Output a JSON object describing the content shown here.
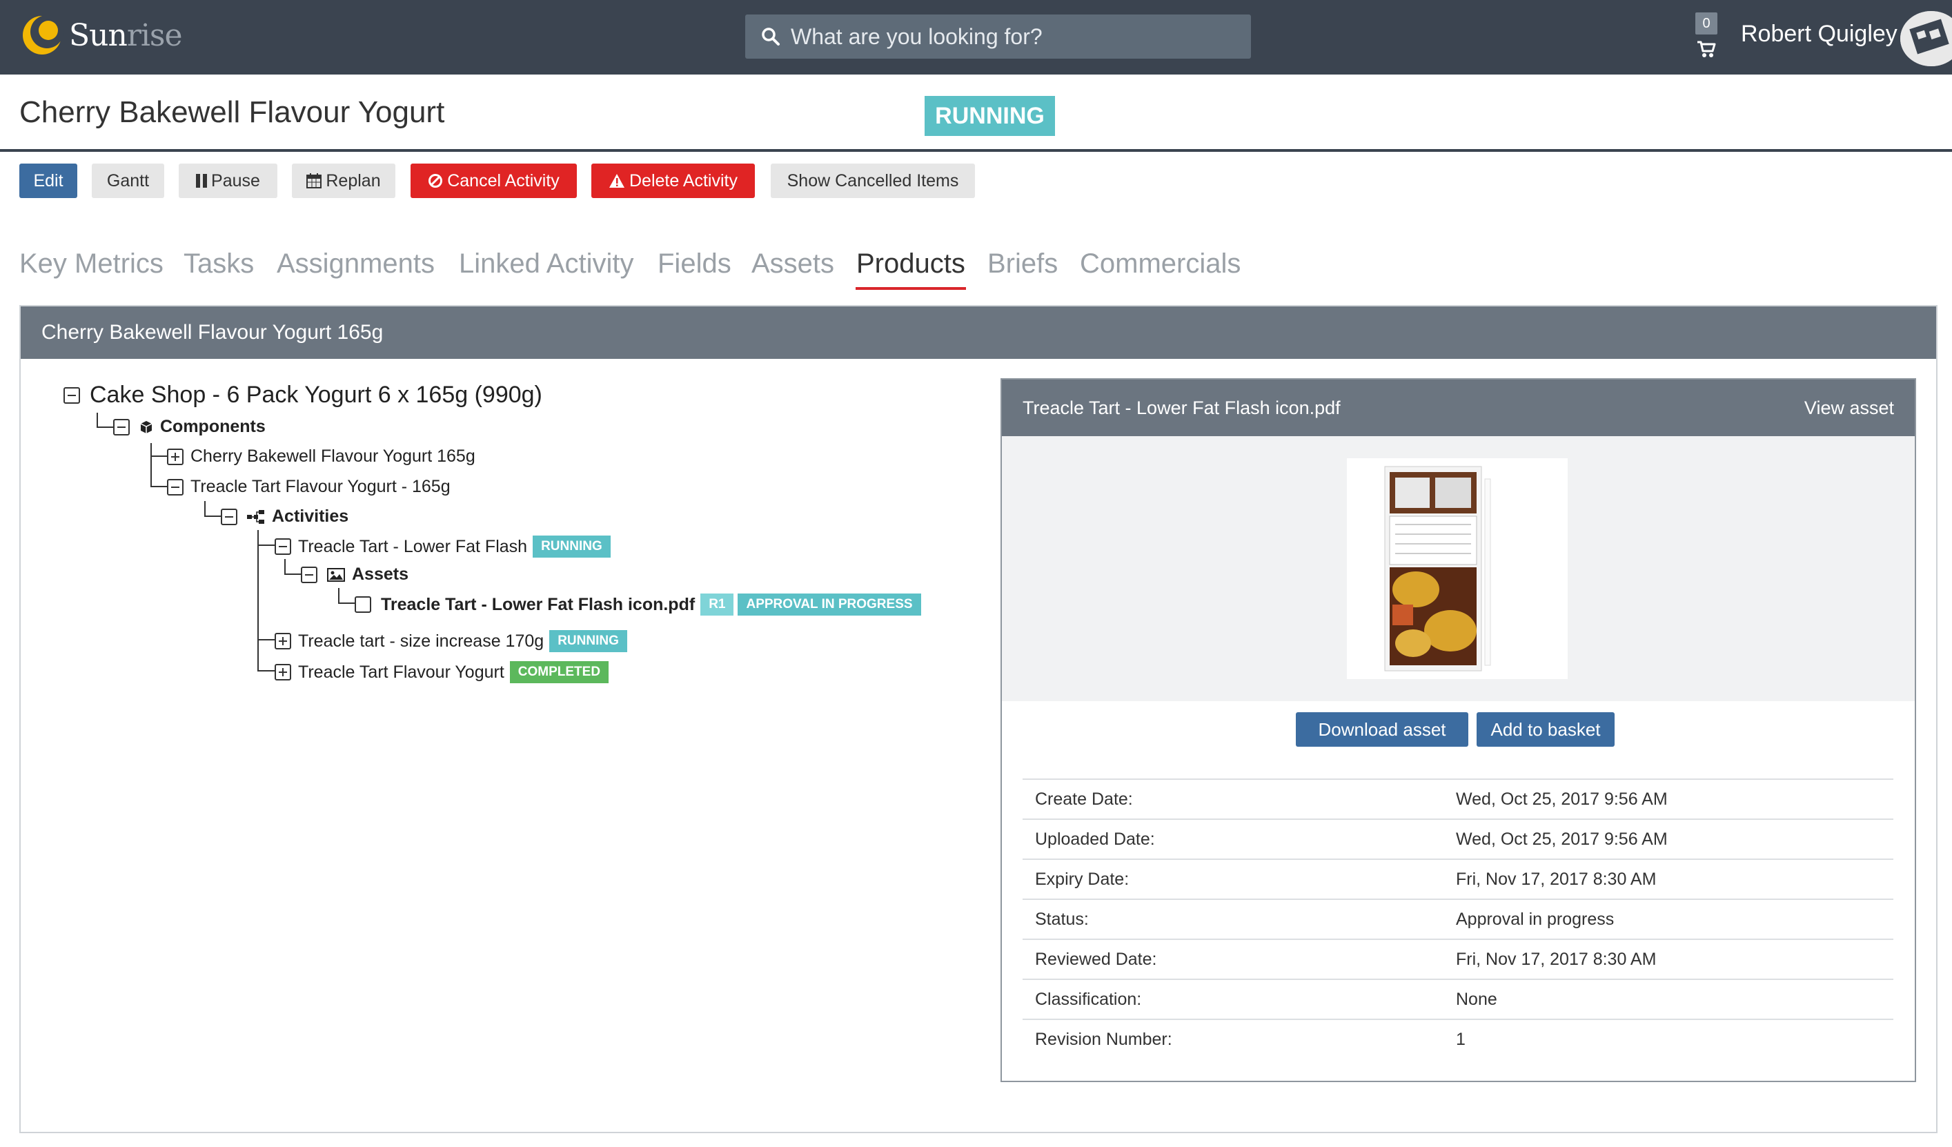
{
  "topbar": {
    "logo_a": "Sun",
    "logo_b": "rise",
    "search_placeholder": "What are you looking for?",
    "cart_count": "0",
    "user_name": "Robert Quigley"
  },
  "header": {
    "title": "Cherry Bakewell Flavour Yogurt",
    "status": "RUNNING"
  },
  "actions": {
    "edit": "Edit",
    "gantt": "Gantt",
    "pause": "Pause",
    "replan": "Replan",
    "cancel": "Cancel Activity",
    "delete": "Delete Activity",
    "show_cancelled": "Show Cancelled Items"
  },
  "tabs": [
    "Key Metrics",
    "Tasks",
    "Assignments",
    "Linked Activity",
    "Fields",
    "Assets",
    "Products",
    "Briefs",
    "Commercials"
  ],
  "active_tab": "Products",
  "panel": {
    "title": "Cherry Bakewell Flavour Yogurt 165g"
  },
  "tree": {
    "root": "Cake Shop - 6 Pack Yogurt 6 x 165g (990g)",
    "components": "Components",
    "comp1": "Cherry Bakewell Flavour Yogurt 165g",
    "comp2": "Treacle Tart Flavour Yogurt - 165g",
    "activities": "Activities",
    "act1": "Treacle Tart - Lower Fat Flash",
    "act1_badge": "RUNNING",
    "assets": "Assets",
    "asset1": "Treacle Tart - Lower Fat Flash icon.pdf",
    "asset1_rev": "R1",
    "asset1_status": "APPROVAL IN PROGRESS",
    "act2": "Treacle tart - size increase 170g",
    "act2_badge": "RUNNING",
    "act3": "Treacle Tart Flavour Yogurt",
    "act3_badge": "COMPLETED"
  },
  "asset_card": {
    "title": "Treacle Tart - Lower Fat Flash icon.pdf",
    "view": "View asset",
    "download": "Download asset",
    "basket": "Add to basket",
    "meta": [
      {
        "k": "Create Date:",
        "v": "Wed, Oct 25, 2017 9:56 AM"
      },
      {
        "k": "Uploaded Date:",
        "v": "Wed, Oct 25, 2017 9:56 AM"
      },
      {
        "k": "Expiry Date:",
        "v": "Fri, Nov 17, 2017 8:30 AM"
      },
      {
        "k": "Status:",
        "v": "Approval in progress"
      },
      {
        "k": "Reviewed Date:",
        "v": "Fri, Nov 17, 2017 8:30 AM"
      },
      {
        "k": "Classification:",
        "v": "None"
      },
      {
        "k": "Revision Number:",
        "v": "1"
      }
    ]
  },
  "colors": {
    "topbar": "#3b4450",
    "primary": "#3c6ca0",
    "danger": "#e02424",
    "running": "#5bc0c6",
    "completed": "#5cb85c",
    "tab_active_underline": "#d9262b"
  }
}
